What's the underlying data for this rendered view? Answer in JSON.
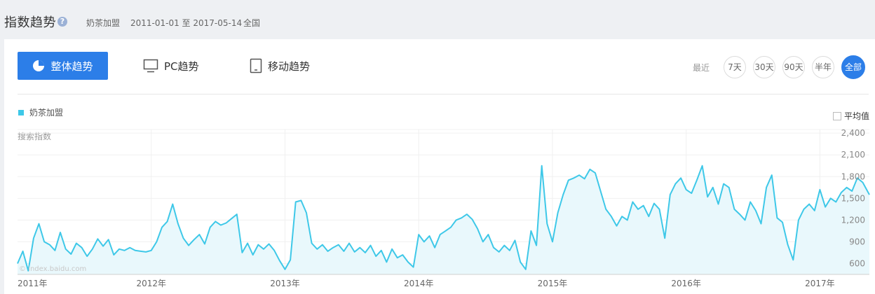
{
  "header": {
    "title": "指数趋势",
    "help_symbol": "?",
    "keyword": "奶茶加盟",
    "date_range": "2011-01-01 至 2017-05-14",
    "region": "全国"
  },
  "tabs": [
    {
      "label": "整体趋势",
      "icon": "pie-chart-icon",
      "active": true
    },
    {
      "label": "PC趋势",
      "icon": "monitor-icon",
      "active": false
    },
    {
      "label": "移动趋势",
      "icon": "tablet-icon",
      "active": false
    }
  ],
  "range_label": "最近",
  "ranges": [
    "7天",
    "30天",
    "90天",
    "半年",
    "全部"
  ],
  "active_range": "全部",
  "legend_label": "奶茶加盟",
  "avg_label": "平均值",
  "y_title": "搜索指数",
  "watermark": "index.baidu.com",
  "colors": {
    "accent": "#2c7ee8",
    "series": "#3ec8e8",
    "fill": "#e9f8fc"
  },
  "chart_data": {
    "type": "area",
    "title": "",
    "ylabel": "搜索指数",
    "ylim": [
      450,
      2450
    ],
    "yticks": [
      600,
      900,
      1200,
      1500,
      1800,
      2100,
      2400
    ],
    "xticks": [
      "2011年",
      "2012年",
      "2013年",
      "2014年",
      "2015年",
      "2016年",
      "2017年"
    ],
    "x_start": 2011.0,
    "x_end": 2017.37,
    "grid": true,
    "legend": "top-left",
    "series": [
      {
        "name": "奶茶加盟",
        "points": [
          [
            2011.0,
            600
          ],
          [
            2011.04,
            770
          ],
          [
            2011.08,
            500
          ],
          [
            2011.12,
            950
          ],
          [
            2011.16,
            1150
          ],
          [
            2011.2,
            900
          ],
          [
            2011.24,
            860
          ],
          [
            2011.28,
            780
          ],
          [
            2011.32,
            1030
          ],
          [
            2011.36,
            800
          ],
          [
            2011.4,
            730
          ],
          [
            2011.44,
            880
          ],
          [
            2011.48,
            820
          ],
          [
            2011.52,
            700
          ],
          [
            2011.56,
            800
          ],
          [
            2011.6,
            940
          ],
          [
            2011.64,
            840
          ],
          [
            2011.68,
            930
          ],
          [
            2011.72,
            720
          ],
          [
            2011.76,
            800
          ],
          [
            2011.8,
            780
          ],
          [
            2011.84,
            820
          ],
          [
            2011.88,
            780
          ],
          [
            2011.92,
            770
          ],
          [
            2011.96,
            760
          ],
          [
            2012.0,
            780
          ],
          [
            2012.04,
            900
          ],
          [
            2012.08,
            1100
          ],
          [
            2012.12,
            1180
          ],
          [
            2012.16,
            1420
          ],
          [
            2012.2,
            1150
          ],
          [
            2012.24,
            950
          ],
          [
            2012.28,
            850
          ],
          [
            2012.32,
            930
          ],
          [
            2012.36,
            1000
          ],
          [
            2012.4,
            870
          ],
          [
            2012.44,
            1100
          ],
          [
            2012.48,
            1180
          ],
          [
            2012.52,
            1130
          ],
          [
            2012.56,
            1160
          ],
          [
            2012.6,
            1220
          ],
          [
            2012.64,
            1280
          ],
          [
            2012.68,
            750
          ],
          [
            2012.72,
            880
          ],
          [
            2012.76,
            720
          ],
          [
            2012.8,
            860
          ],
          [
            2012.84,
            800
          ],
          [
            2012.88,
            870
          ],
          [
            2012.92,
            780
          ],
          [
            2012.96,
            640
          ],
          [
            2013.0,
            520
          ],
          [
            2013.04,
            650
          ],
          [
            2013.08,
            1450
          ],
          [
            2013.12,
            1470
          ],
          [
            2013.16,
            1300
          ],
          [
            2013.2,
            880
          ],
          [
            2013.24,
            800
          ],
          [
            2013.28,
            860
          ],
          [
            2013.32,
            770
          ],
          [
            2013.36,
            820
          ],
          [
            2013.4,
            860
          ],
          [
            2013.44,
            770
          ],
          [
            2013.48,
            880
          ],
          [
            2013.52,
            760
          ],
          [
            2013.56,
            820
          ],
          [
            2013.6,
            750
          ],
          [
            2013.64,
            850
          ],
          [
            2013.68,
            700
          ],
          [
            2013.72,
            780
          ],
          [
            2013.76,
            620
          ],
          [
            2013.8,
            800
          ],
          [
            2013.84,
            680
          ],
          [
            2013.88,
            720
          ],
          [
            2013.92,
            620
          ],
          [
            2013.96,
            550
          ],
          [
            2014.0,
            1000
          ],
          [
            2014.04,
            900
          ],
          [
            2014.08,
            980
          ],
          [
            2014.12,
            820
          ],
          [
            2014.16,
            1000
          ],
          [
            2014.2,
            1050
          ],
          [
            2014.24,
            1100
          ],
          [
            2014.28,
            1200
          ],
          [
            2014.32,
            1230
          ],
          [
            2014.36,
            1280
          ],
          [
            2014.4,
            1210
          ],
          [
            2014.44,
            1080
          ],
          [
            2014.48,
            900
          ],
          [
            2014.52,
            1000
          ],
          [
            2014.56,
            820
          ],
          [
            2014.6,
            760
          ],
          [
            2014.64,
            850
          ],
          [
            2014.68,
            780
          ],
          [
            2014.72,
            920
          ],
          [
            2014.76,
            620
          ],
          [
            2014.8,
            520
          ],
          [
            2014.84,
            1050
          ],
          [
            2014.88,
            850
          ],
          [
            2014.92,
            1950
          ],
          [
            2014.96,
            1150
          ],
          [
            2015.0,
            900
          ],
          [
            2015.04,
            1300
          ],
          [
            2015.08,
            1550
          ],
          [
            2015.12,
            1750
          ],
          [
            2015.16,
            1780
          ],
          [
            2015.2,
            1820
          ],
          [
            2015.24,
            1770
          ],
          [
            2015.28,
            1900
          ],
          [
            2015.32,
            1850
          ],
          [
            2015.36,
            1600
          ],
          [
            2015.4,
            1350
          ],
          [
            2015.44,
            1250
          ],
          [
            2015.48,
            1120
          ],
          [
            2015.52,
            1250
          ],
          [
            2015.56,
            1200
          ],
          [
            2015.6,
            1450
          ],
          [
            2015.64,
            1350
          ],
          [
            2015.68,
            1400
          ],
          [
            2015.72,
            1250
          ],
          [
            2015.76,
            1430
          ],
          [
            2015.8,
            1350
          ],
          [
            2015.84,
            950
          ],
          [
            2015.88,
            1550
          ],
          [
            2015.92,
            1700
          ],
          [
            2015.96,
            1780
          ],
          [
            2016.0,
            1620
          ],
          [
            2016.04,
            1570
          ],
          [
            2016.08,
            1750
          ],
          [
            2016.12,
            1950
          ],
          [
            2016.16,
            1520
          ],
          [
            2016.2,
            1650
          ],
          [
            2016.24,
            1420
          ],
          [
            2016.28,
            1700
          ],
          [
            2016.32,
            1650
          ],
          [
            2016.36,
            1350
          ],
          [
            2016.4,
            1280
          ],
          [
            2016.44,
            1200
          ],
          [
            2016.48,
            1450
          ],
          [
            2016.52,
            1330
          ],
          [
            2016.56,
            1150
          ],
          [
            2016.6,
            1650
          ],
          [
            2016.64,
            1820
          ],
          [
            2016.68,
            1230
          ],
          [
            2016.72,
            1170
          ],
          [
            2016.76,
            860
          ],
          [
            2016.8,
            650
          ],
          [
            2016.84,
            1200
          ],
          [
            2016.88,
            1350
          ],
          [
            2016.92,
            1420
          ],
          [
            2016.96,
            1330
          ],
          [
            2017.0,
            1620
          ],
          [
            2017.04,
            1380
          ],
          [
            2017.08,
            1500
          ],
          [
            2017.12,
            1450
          ],
          [
            2017.16,
            1580
          ],
          [
            2017.2,
            1650
          ],
          [
            2017.24,
            1600
          ],
          [
            2017.28,
            1780
          ],
          [
            2017.32,
            1720
          ],
          [
            2017.37,
            1550
          ]
        ]
      }
    ]
  }
}
